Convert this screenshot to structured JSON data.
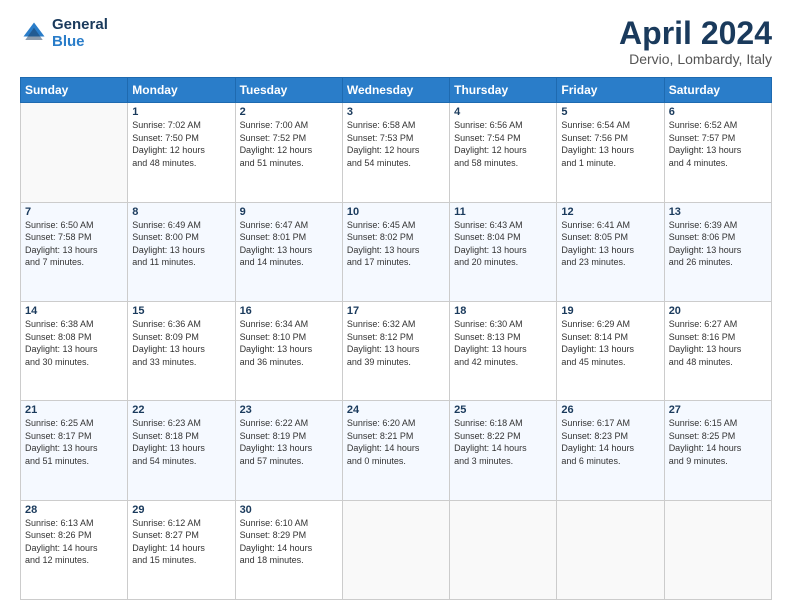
{
  "header": {
    "logo_line1": "General",
    "logo_line2": "Blue",
    "title": "April 2024",
    "subtitle": "Dervio, Lombardy, Italy"
  },
  "columns": [
    "Sunday",
    "Monday",
    "Tuesday",
    "Wednesday",
    "Thursday",
    "Friday",
    "Saturday"
  ],
  "weeks": [
    [
      {
        "day": "",
        "info": ""
      },
      {
        "day": "1",
        "info": "Sunrise: 7:02 AM\nSunset: 7:50 PM\nDaylight: 12 hours\nand 48 minutes."
      },
      {
        "day": "2",
        "info": "Sunrise: 7:00 AM\nSunset: 7:52 PM\nDaylight: 12 hours\nand 51 minutes."
      },
      {
        "day": "3",
        "info": "Sunrise: 6:58 AM\nSunset: 7:53 PM\nDaylight: 12 hours\nand 54 minutes."
      },
      {
        "day": "4",
        "info": "Sunrise: 6:56 AM\nSunset: 7:54 PM\nDaylight: 12 hours\nand 58 minutes."
      },
      {
        "day": "5",
        "info": "Sunrise: 6:54 AM\nSunset: 7:56 PM\nDaylight: 13 hours\nand 1 minute."
      },
      {
        "day": "6",
        "info": "Sunrise: 6:52 AM\nSunset: 7:57 PM\nDaylight: 13 hours\nand 4 minutes."
      }
    ],
    [
      {
        "day": "7",
        "info": "Sunrise: 6:50 AM\nSunset: 7:58 PM\nDaylight: 13 hours\nand 7 minutes."
      },
      {
        "day": "8",
        "info": "Sunrise: 6:49 AM\nSunset: 8:00 PM\nDaylight: 13 hours\nand 11 minutes."
      },
      {
        "day": "9",
        "info": "Sunrise: 6:47 AM\nSunset: 8:01 PM\nDaylight: 13 hours\nand 14 minutes."
      },
      {
        "day": "10",
        "info": "Sunrise: 6:45 AM\nSunset: 8:02 PM\nDaylight: 13 hours\nand 17 minutes."
      },
      {
        "day": "11",
        "info": "Sunrise: 6:43 AM\nSunset: 8:04 PM\nDaylight: 13 hours\nand 20 minutes."
      },
      {
        "day": "12",
        "info": "Sunrise: 6:41 AM\nSunset: 8:05 PM\nDaylight: 13 hours\nand 23 minutes."
      },
      {
        "day": "13",
        "info": "Sunrise: 6:39 AM\nSunset: 8:06 PM\nDaylight: 13 hours\nand 26 minutes."
      }
    ],
    [
      {
        "day": "14",
        "info": "Sunrise: 6:38 AM\nSunset: 8:08 PM\nDaylight: 13 hours\nand 30 minutes."
      },
      {
        "day": "15",
        "info": "Sunrise: 6:36 AM\nSunset: 8:09 PM\nDaylight: 13 hours\nand 33 minutes."
      },
      {
        "day": "16",
        "info": "Sunrise: 6:34 AM\nSunset: 8:10 PM\nDaylight: 13 hours\nand 36 minutes."
      },
      {
        "day": "17",
        "info": "Sunrise: 6:32 AM\nSunset: 8:12 PM\nDaylight: 13 hours\nand 39 minutes."
      },
      {
        "day": "18",
        "info": "Sunrise: 6:30 AM\nSunset: 8:13 PM\nDaylight: 13 hours\nand 42 minutes."
      },
      {
        "day": "19",
        "info": "Sunrise: 6:29 AM\nSunset: 8:14 PM\nDaylight: 13 hours\nand 45 minutes."
      },
      {
        "day": "20",
        "info": "Sunrise: 6:27 AM\nSunset: 8:16 PM\nDaylight: 13 hours\nand 48 minutes."
      }
    ],
    [
      {
        "day": "21",
        "info": "Sunrise: 6:25 AM\nSunset: 8:17 PM\nDaylight: 13 hours\nand 51 minutes."
      },
      {
        "day": "22",
        "info": "Sunrise: 6:23 AM\nSunset: 8:18 PM\nDaylight: 13 hours\nand 54 minutes."
      },
      {
        "day": "23",
        "info": "Sunrise: 6:22 AM\nSunset: 8:19 PM\nDaylight: 13 hours\nand 57 minutes."
      },
      {
        "day": "24",
        "info": "Sunrise: 6:20 AM\nSunset: 8:21 PM\nDaylight: 14 hours\nand 0 minutes."
      },
      {
        "day": "25",
        "info": "Sunrise: 6:18 AM\nSunset: 8:22 PM\nDaylight: 14 hours\nand 3 minutes."
      },
      {
        "day": "26",
        "info": "Sunrise: 6:17 AM\nSunset: 8:23 PM\nDaylight: 14 hours\nand 6 minutes."
      },
      {
        "day": "27",
        "info": "Sunrise: 6:15 AM\nSunset: 8:25 PM\nDaylight: 14 hours\nand 9 minutes."
      }
    ],
    [
      {
        "day": "28",
        "info": "Sunrise: 6:13 AM\nSunset: 8:26 PM\nDaylight: 14 hours\nand 12 minutes."
      },
      {
        "day": "29",
        "info": "Sunrise: 6:12 AM\nSunset: 8:27 PM\nDaylight: 14 hours\nand 15 minutes."
      },
      {
        "day": "30",
        "info": "Sunrise: 6:10 AM\nSunset: 8:29 PM\nDaylight: 14 hours\nand 18 minutes."
      },
      {
        "day": "",
        "info": ""
      },
      {
        "day": "",
        "info": ""
      },
      {
        "day": "",
        "info": ""
      },
      {
        "day": "",
        "info": ""
      }
    ]
  ]
}
